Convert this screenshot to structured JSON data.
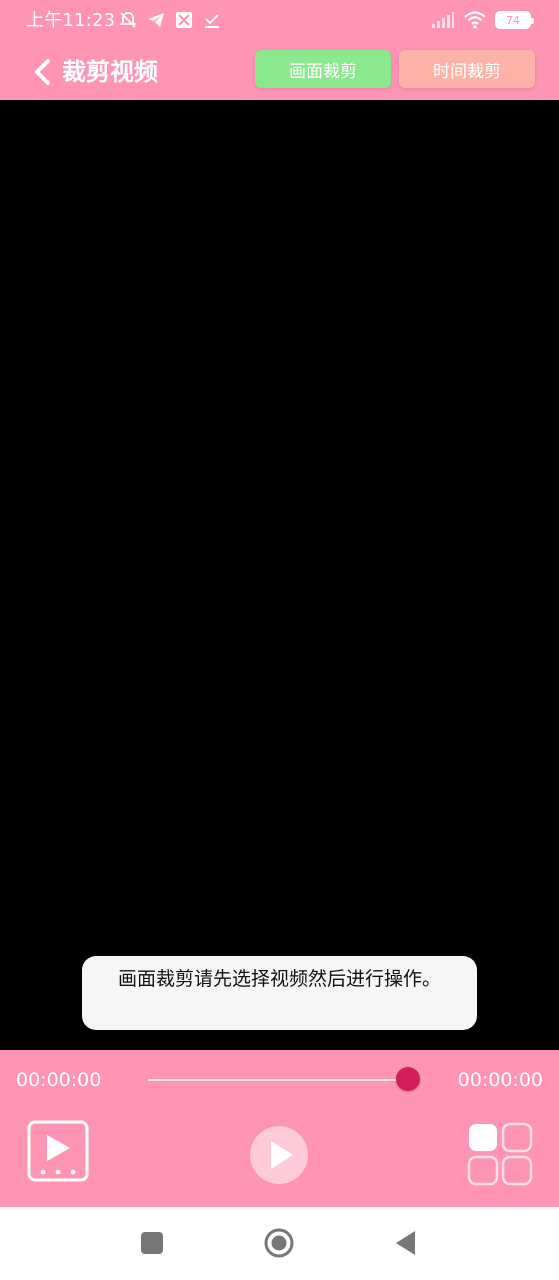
{
  "status_bar": {
    "time": "上午11:23",
    "battery": "74",
    "notification_icons": [
      "notification-muted-icon",
      "telegram-icon",
      "app-icon",
      "download-done-icon"
    ],
    "system_icons": [
      "signal-icon",
      "wifi-icon",
      "battery-icon"
    ]
  },
  "app_bar": {
    "title": "裁剪视频",
    "back_icon": "chevron-left-icon",
    "crop_frame_label": "画面裁剪",
    "crop_time_label": "时间裁剪"
  },
  "toast": {
    "message": "画面裁剪请先选择视频然后进行操作。"
  },
  "player": {
    "current_time": "00:00:00",
    "total_time": "00:00:00",
    "progress": 1.0
  },
  "controls": {
    "video_icon": "video-file-icon",
    "play_icon": "play-icon",
    "grid_icon": "grid-icon"
  },
  "nav_bar": {
    "recent_icon": "recents-square-icon",
    "home_icon": "home-circle-icon",
    "back_icon": "back-triangle-icon"
  },
  "colors": {
    "primary_pink": "#FF94B5",
    "green_button": "#8BE88E",
    "salmon_button": "#FFB3A8",
    "slider_thumb": "#D41E5C",
    "video_bg": "#000000"
  }
}
